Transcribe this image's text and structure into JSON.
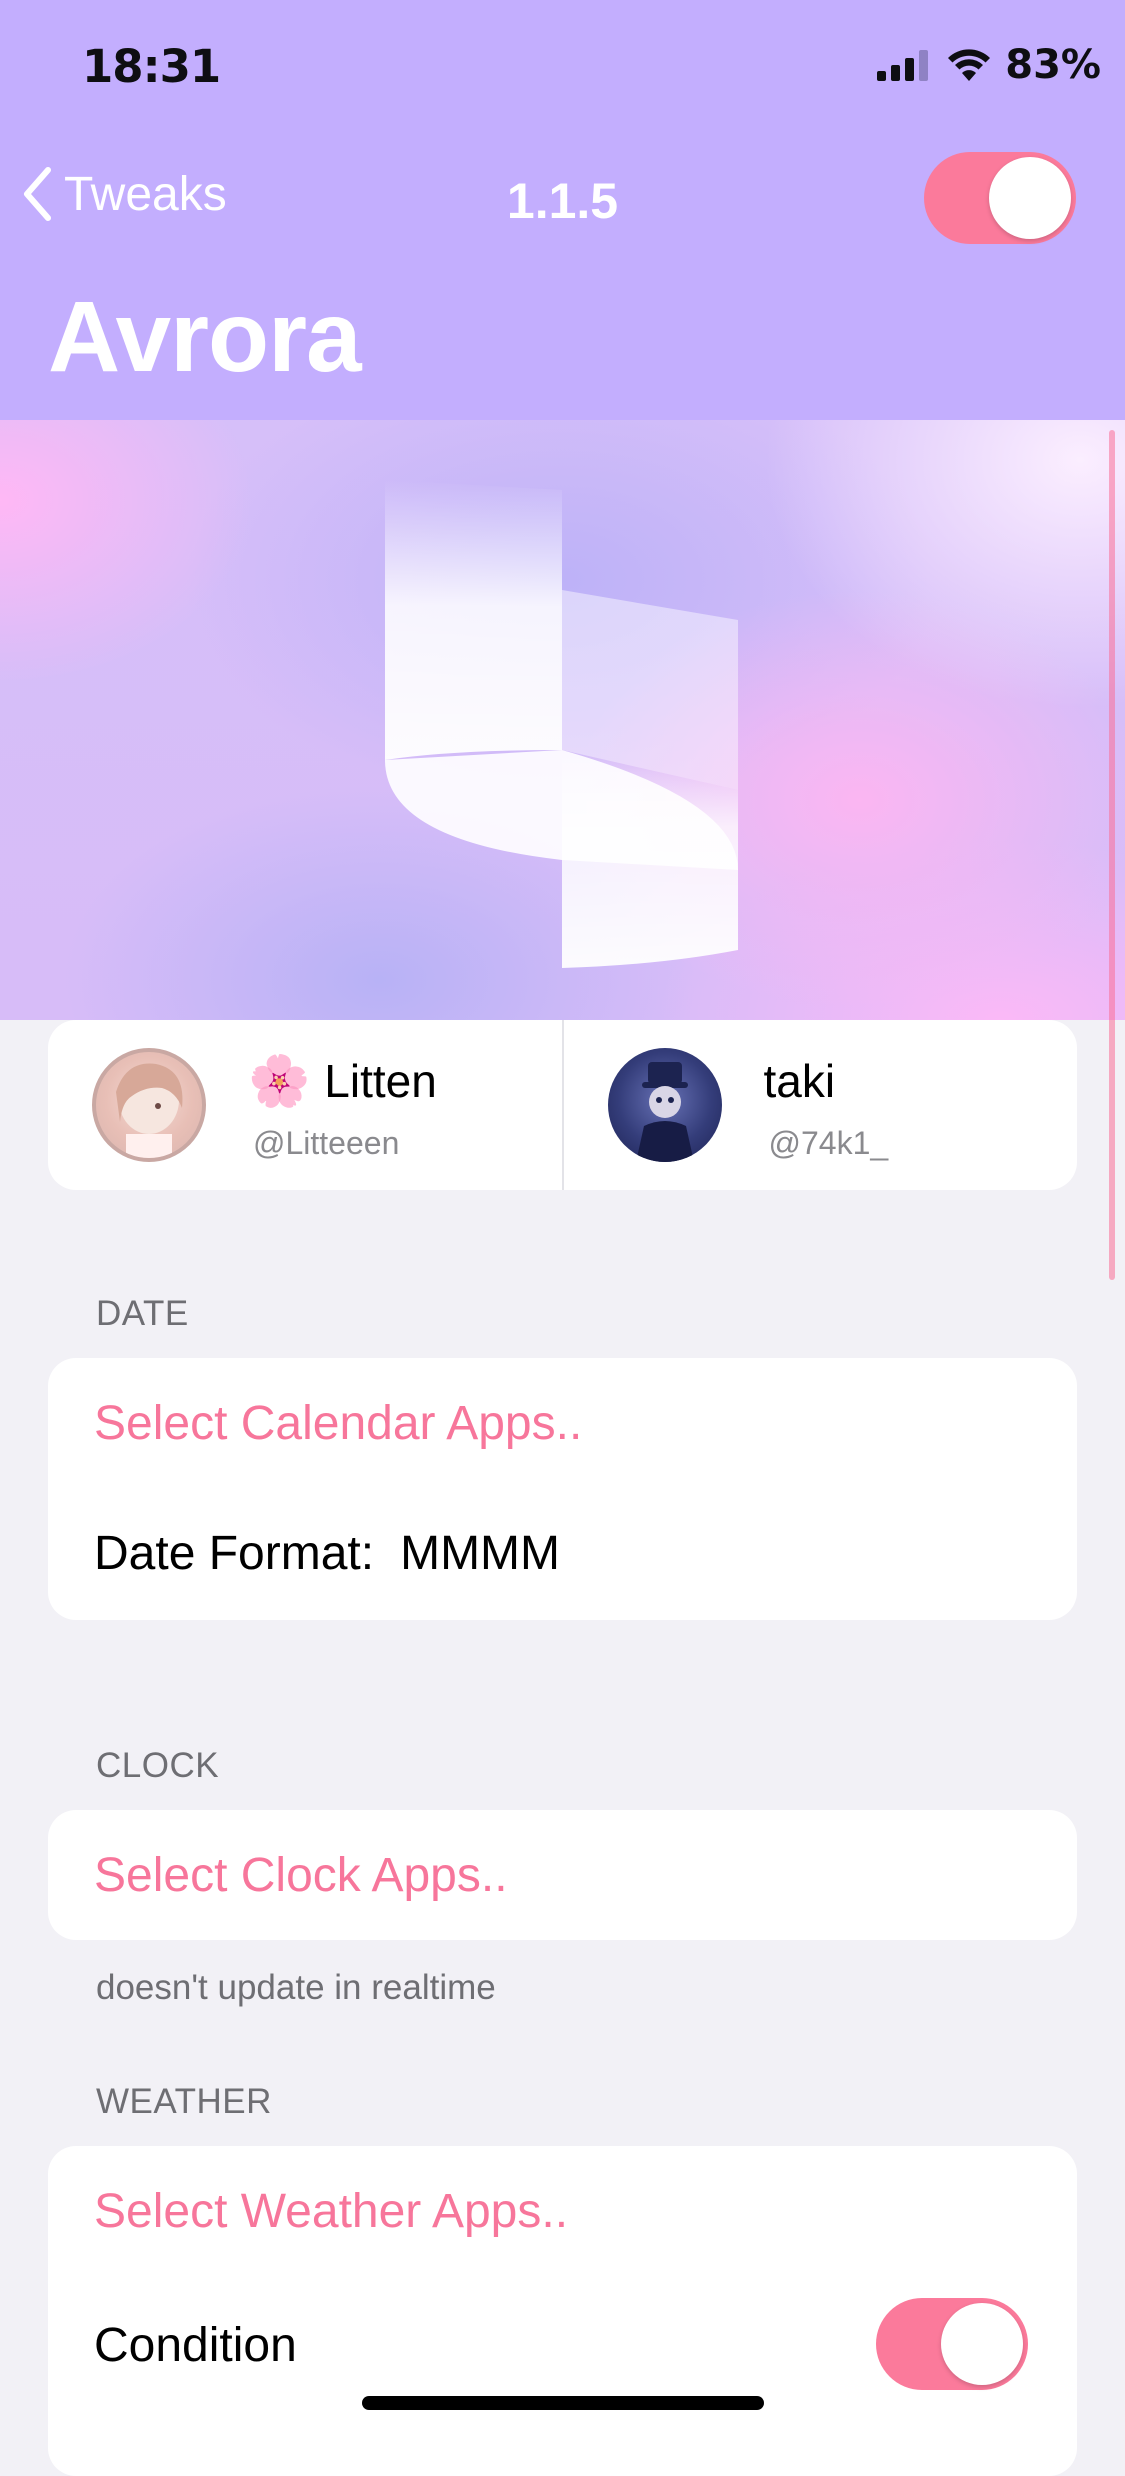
{
  "status_bar": {
    "time": "18:31",
    "battery": "83%"
  },
  "nav": {
    "back_label": "Tweaks",
    "title": "1.1.5",
    "enabled": true
  },
  "page_title": "Avrora",
  "authors": [
    {
      "name": "Litten",
      "handle": "@Litteeen",
      "emoji": "🌸"
    },
    {
      "name": "taki",
      "handle": "@74k1_"
    }
  ],
  "sections": {
    "date": {
      "header": "DATE",
      "select_label": "Select Calendar Apps..",
      "format_label": "Date Format:",
      "format_value": "MMMM"
    },
    "clock": {
      "header": "CLOCK",
      "select_label": "Select Clock Apps..",
      "footer": "doesn't update in realtime"
    },
    "weather": {
      "header": "WEATHER",
      "select_label": "Select Weather Apps..",
      "condition_label": "Condition",
      "condition_enabled": true
    }
  },
  "colors": {
    "header": "#c3aefe",
    "accent": "#fb7a9b",
    "link": "#f7769b",
    "background": "#f2f1f6"
  }
}
